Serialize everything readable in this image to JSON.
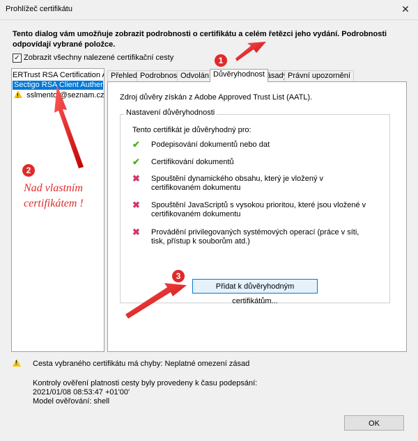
{
  "window": {
    "title": "Prohlížeč certifikátu",
    "close_glyph": "✕"
  },
  "intro": "Tento dialog vám umožňuje zobrazit podrobnosti o certifikátu a celém řetězci jeho vydání. Podrobnosti odpovídají vybrané položce.",
  "show_all_paths": {
    "label": "Zobrazit všechny nalezené certifikační cesty",
    "checked": true
  },
  "tree": {
    "items": [
      {
        "label": "ERTrust RSA Certification Auth"
      },
      {
        "label": "Sectigo RSA Client Authentica",
        "selected": true
      },
      {
        "label": "sslmentor@seznam.cz",
        "warning_icon": "warning-triangle-icon"
      }
    ]
  },
  "tabs": [
    {
      "label": "Přehled"
    },
    {
      "label": "Podrobnosti"
    },
    {
      "label": "Odvolání"
    },
    {
      "label": "Důvěryhodnost",
      "active": true
    },
    {
      "label": "Zásady"
    },
    {
      "label": "Právní upozornění"
    }
  ],
  "trust": {
    "source": "Zdroj důvěry získán z Adobe Approved Trust List (AATL).",
    "group_title": "Nastavení důvěryhodnosti",
    "trusted_for": "Tento certifikát je důvěryhodný pro:",
    "permissions": [
      {
        "label": "Podepisování dokumentů nebo dat",
        "allowed": true,
        "icon": "check-icon"
      },
      {
        "label": "Certifikování dokumentů",
        "allowed": true,
        "icon": "check-icon"
      },
      {
        "label": "Spouštění dynamického obsahu, který je vložený v certifikovaném dokumentu",
        "allowed": false,
        "icon": "cross-icon"
      },
      {
        "label": "Spouštění JavaScriptů s vysokou prioritou, které jsou vložené v certifikovaném dokumentu",
        "allowed": false,
        "icon": "cross-icon"
      },
      {
        "label": "Provádění privilegovaných systémových operací (práce v síti, tisk, přístup k souborům atd.)",
        "allowed": false,
        "icon": "cross-icon"
      }
    ],
    "add_button": "Přidat k důvěryhodným certifikátům..."
  },
  "status": {
    "icon": "warning-triangle-icon",
    "text": "Cesta vybraného certifikátu má chyby: Neplatné omezení zásad",
    "verification_line1": "Kontroly ověření platnosti cesty byly provedeny k času podepsání:",
    "verification_time": "2021/01/08 08:53:47 +01'00'",
    "verification_model": "Model ověřování: shell"
  },
  "ok_button": "OK",
  "annotations": {
    "badge1": "1",
    "badge2": "2",
    "badge3": "3",
    "text_line1": "Nad vlastním",
    "text_line2": "certifikátem !",
    "color": "#e02a2a"
  }
}
